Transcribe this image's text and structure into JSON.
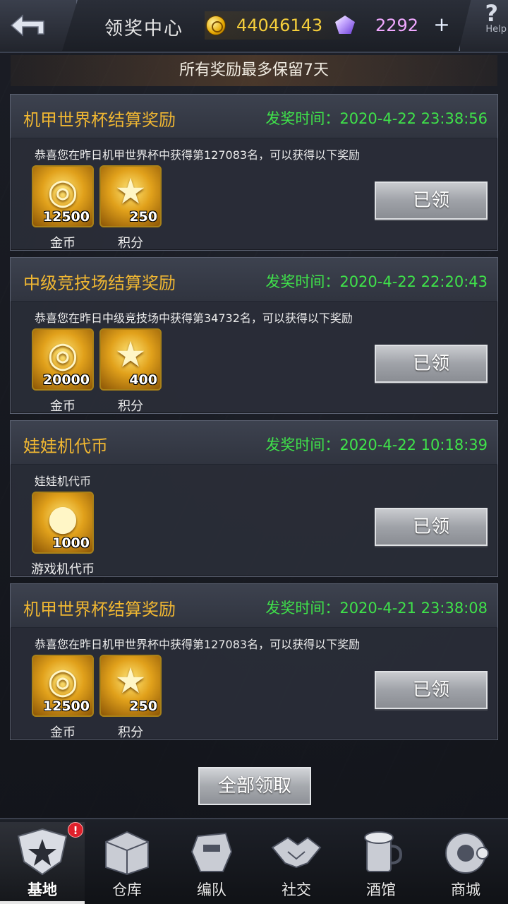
{
  "header": {
    "title": "领奖中心",
    "gold": "44046143",
    "gems": "2292",
    "plus": "+",
    "help_q": "?",
    "help_label": "Help"
  },
  "notice": "所有奖励最多保留7天",
  "cards": [
    {
      "title": "机甲世界杯结算奖励",
      "time": "发奖时间：2020-4-22 23:38:56",
      "desc": "恭喜您在昨日机甲世界杯中获得第127083名，可以获得以下奖励",
      "items": [
        {
          "icon": "gold-coins-icon",
          "qty": "12500",
          "name": "金币"
        },
        {
          "icon": "star-points-icon",
          "qty": "250",
          "name": "积分"
        }
      ],
      "button": "已领"
    },
    {
      "title": "中级竞技场结算奖励",
      "time": "发奖时间：2020-4-22 22:20:43",
      "desc": "恭喜您在昨日中级竞技场中获得第34732名，可以获得以下奖励",
      "items": [
        {
          "icon": "gold-coins-icon",
          "qty": "20000",
          "name": "金币"
        },
        {
          "icon": "star-points-icon",
          "qty": "400",
          "name": "积分"
        }
      ],
      "button": "已领"
    },
    {
      "title": "娃娃机代币",
      "time": "发奖时间：2020-4-22 10:18:39",
      "desc": "娃娃机代币",
      "items": [
        {
          "icon": "game-token-icon",
          "qty": "1000",
          "name": "游戏机代币"
        }
      ],
      "button": "已领"
    },
    {
      "title": "机甲世界杯结算奖励",
      "time": "发奖时间：2020-4-21 23:38:08",
      "desc": "恭喜您在昨日机甲世界杯中获得第127083名，可以获得以下奖励",
      "items": [
        {
          "icon": "gold-coins-icon",
          "qty": "12500",
          "name": "金币"
        },
        {
          "icon": "star-points-icon",
          "qty": "250",
          "name": "积分"
        }
      ],
      "button": "已领"
    }
  ],
  "claim_all": "全部领取",
  "nav": [
    {
      "label": "基地",
      "icon": "base-icon",
      "badge": "!"
    },
    {
      "label": "仓库",
      "icon": "warehouse-icon"
    },
    {
      "label": "编队",
      "icon": "formation-icon"
    },
    {
      "label": "社交",
      "icon": "social-icon"
    },
    {
      "label": "酒馆",
      "icon": "tavern-icon"
    },
    {
      "label": "商城",
      "icon": "shop-icon"
    }
  ],
  "colors": {
    "title_gold": "#f0b732",
    "time_green": "#3fe24a",
    "gold_text": "#f6cf3b",
    "gem_text": "#f0a8ff"
  }
}
